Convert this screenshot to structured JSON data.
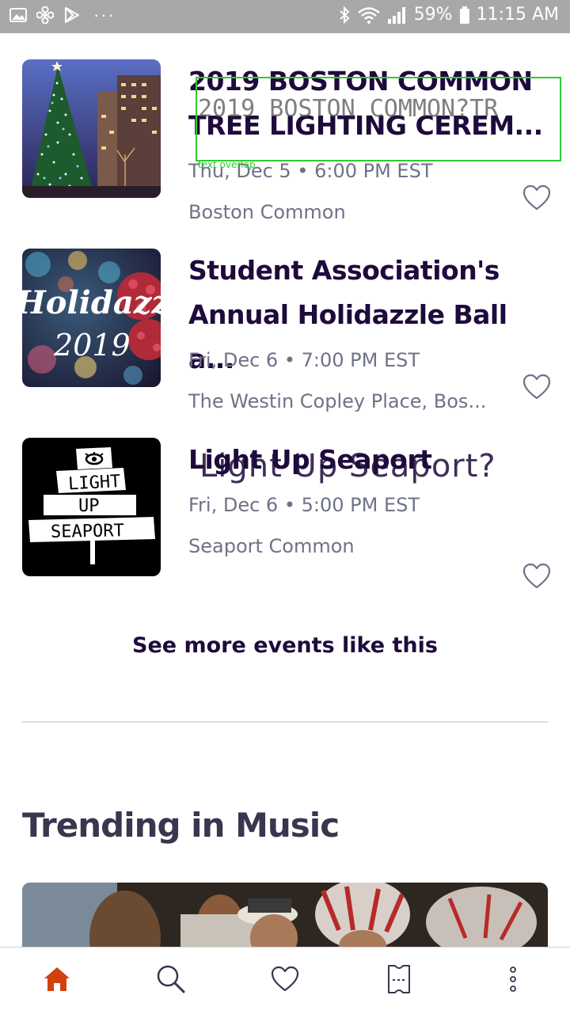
{
  "status_bar": {
    "battery": "59%",
    "time": "11:15 AM",
    "overflow": "···"
  },
  "events": [
    {
      "title": "2019 BOSTON COMMON TREE LIGHTING CEREM...",
      "date": "Thu, Dec 5 • 6:00 PM EST",
      "venue": "Boston Common"
    },
    {
      "title": "Student Association's Annual Holidazzle Ball a...",
      "date": "Fri, Dec 6 • 7:00 PM EST",
      "venue": "The Westin Copley Place, Bos...",
      "image_text_line1": "Holidazzl",
      "image_text_line2": "2019"
    },
    {
      "title": "Light Up Seaport",
      "date": "Fri, Dec 6 • 5:00 PM EST",
      "venue": "Seaport Common",
      "image_sign_1": "LIGHT",
      "image_sign_2": "UP",
      "image_sign_3": "SEAPORT"
    }
  ],
  "annotation": {
    "text_1": "2019 BOSTON COMMON?TR",
    "label": "text overlap",
    "text_2": "Light Up Seaport?"
  },
  "see_more": "See more events like this",
  "section_title": "Trending in Music",
  "colors": {
    "title": "#1e0a3c",
    "meta": "#6f7287",
    "accent": "#d1410c",
    "status_bar": "#a8a8a8",
    "annotation": "#2ecc2e"
  },
  "bottom_nav": [
    "home-icon",
    "search-icon",
    "heart-icon",
    "tickets-icon",
    "more-icon"
  ]
}
